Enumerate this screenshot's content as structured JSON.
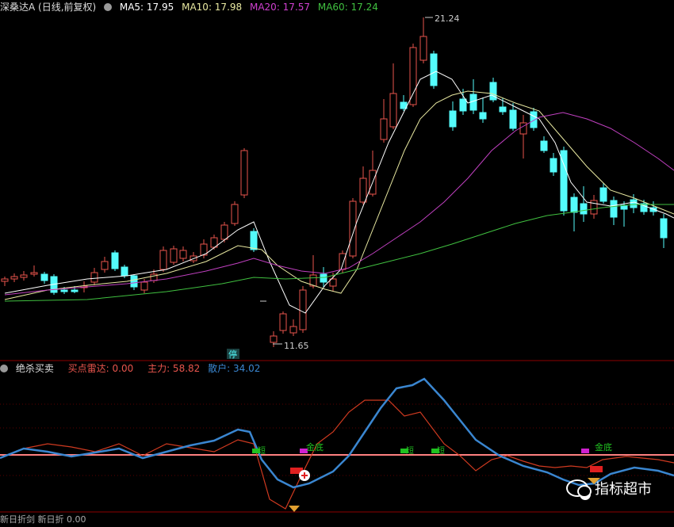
{
  "main_header": {
    "title": "深桑达A (日线,前复权)",
    "ma5": "MA5: 17.95",
    "ma10": "MA10: 17.98",
    "ma20": "MA20: 17.57",
    "ma60": "MA60: 17.24"
  },
  "price_panel": {
    "high_label": "21.24",
    "low_label": "11.65",
    "suspend_label": "停"
  },
  "indicator_header": {
    "name": "绝杀买卖",
    "buy_radar": "买点雷达: 0.00",
    "main_force": "主力: 58.82",
    "retail": "散户: 34.02"
  },
  "signals": {
    "jindi_label": "金底",
    "shortline_label": "短"
  },
  "bottom_header": {
    "text": "新日折剑 新日折 0.00"
  },
  "watermark": {
    "text": "指标超市"
  },
  "colors": {
    "background": "#000000",
    "up": "#e8554d",
    "down": "#54fcfc",
    "ma5": "#ffffff",
    "ma10": "#e8e8a0",
    "ma20": "#c040c0",
    "ma60": "#40c040",
    "main_force": "#d03a20",
    "retail": "#3a86d0",
    "baseline": "#ff8080",
    "grid": "#8b0000"
  },
  "icons": [
    "gear-icon",
    "arrow-icon",
    "plus-icon",
    "diamond-icon",
    "wechat-icon"
  ]
}
